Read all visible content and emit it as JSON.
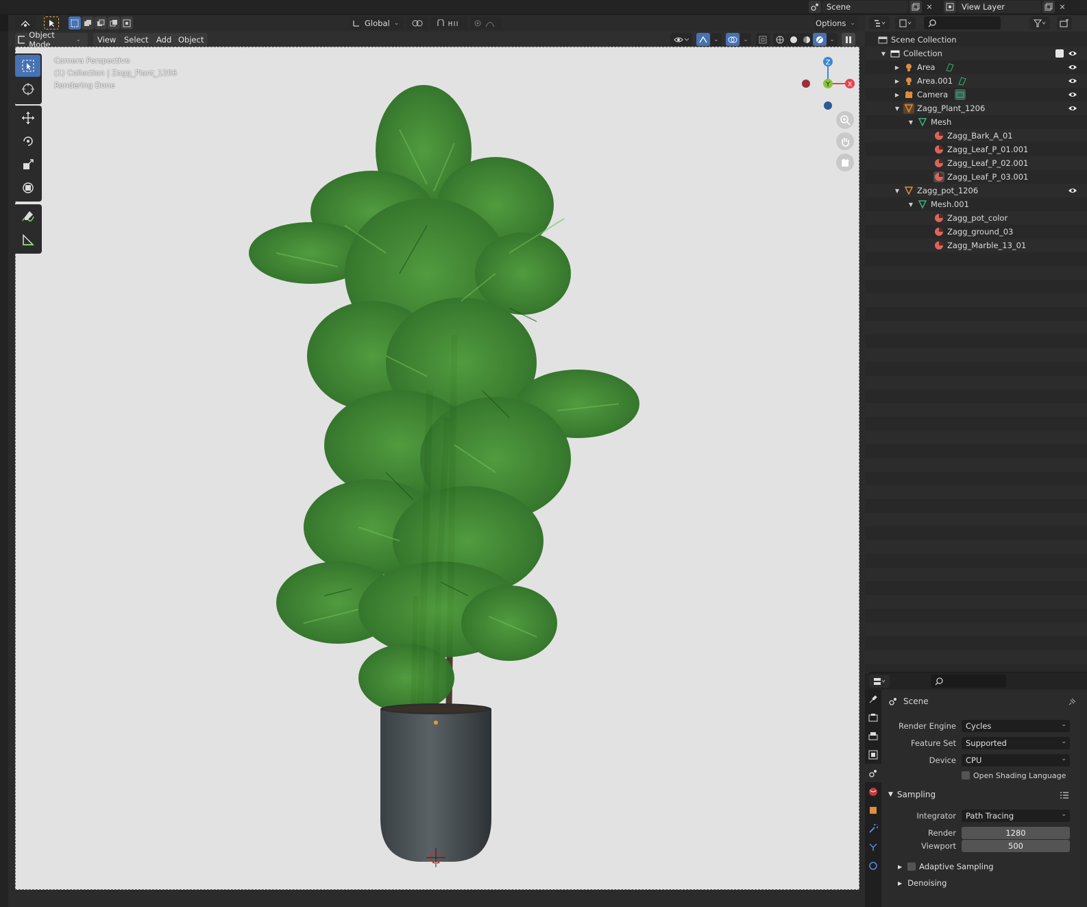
{
  "topbar": {
    "scene_label": "Scene",
    "view_layer_label": "View Layer"
  },
  "viewport_header": {
    "transform_orientation": "Global",
    "options_label": "Options",
    "mode": "Object Mode",
    "menus": [
      "View",
      "Select",
      "Add",
      "Object"
    ]
  },
  "viewport": {
    "overlay_lines": [
      "Camera Perspective",
      "(1) Collection | Zagg_Plant_1206",
      "Rendering Done"
    ],
    "gizmo": {
      "z": "Z",
      "y": "Y",
      "x": "X"
    }
  },
  "outliner": {
    "rows": [
      {
        "label": "Scene Collection",
        "type": "scene"
      },
      {
        "label": "Collection",
        "type": "collection"
      },
      {
        "label": "Area",
        "type": "light"
      },
      {
        "label": "Area.001",
        "type": "light"
      },
      {
        "label": "Camera",
        "type": "camera"
      },
      {
        "label": "Zagg_Plant_1206",
        "type": "object"
      },
      {
        "label": "Mesh",
        "type": "mesh"
      },
      {
        "label": "Zagg_Bark_A_01",
        "type": "material"
      },
      {
        "label": "Zagg_Leaf_P_01.001",
        "type": "material"
      },
      {
        "label": "Zagg_Leaf_P_02.001",
        "type": "material"
      },
      {
        "label": "Zagg_Leaf_P_03.001",
        "type": "material"
      },
      {
        "label": "Zagg_pot_1206",
        "type": "object"
      },
      {
        "label": "Mesh.001",
        "type": "mesh"
      },
      {
        "label": "Zagg_pot_color",
        "type": "material"
      },
      {
        "label": "Zagg_ground_03",
        "type": "material"
      },
      {
        "label": "Zagg_Marble_13_01",
        "type": "material"
      }
    ]
  },
  "properties": {
    "context": "Scene",
    "render_engine_label": "Render Engine",
    "render_engine": "Cycles",
    "feature_set_label": "Feature Set",
    "feature_set": "Supported",
    "device_label": "Device",
    "device": "CPU",
    "osl_label": "Open Shading Language",
    "sampling_title": "Sampling",
    "integrator_label": "Integrator",
    "integrator": "Path Tracing",
    "render_label": "Render",
    "render_samples": "1280",
    "viewport_label": "Viewport",
    "viewport_samples": "500",
    "adaptive_label": "Adaptive Sampling",
    "denoising_label": "Denoising"
  },
  "colors": {
    "accent": "#4772b3",
    "axis_x": "#e8404f",
    "axis_y": "#8bc43a",
    "axis_z": "#3d86d6",
    "object_orange": "#e08d3c",
    "mesh_green": "#3fb07a",
    "material_red": "#d9655b"
  }
}
